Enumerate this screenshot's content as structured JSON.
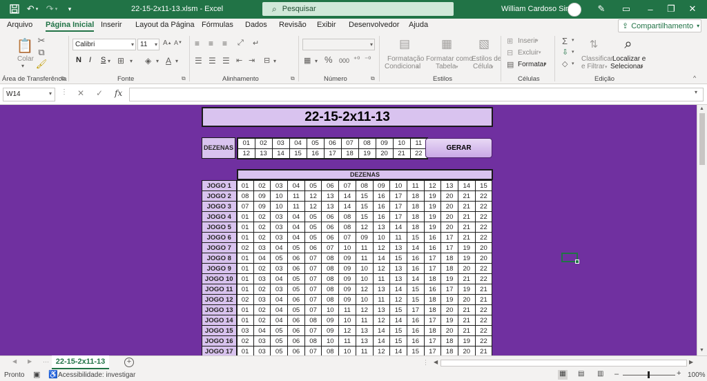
{
  "titlebar": {
    "filename": "22-15-2x11-13.xlsm  -  Excel",
    "search_placeholder": "Pesquisar",
    "user_name": "William Cardoso Simas"
  },
  "tabs": [
    "Arquivo",
    "Página Inicial",
    "Inserir",
    "Layout da Página",
    "Fórmulas",
    "Dados",
    "Revisão",
    "Exibir",
    "Desenvolvedor",
    "Ajuda"
  ],
  "share_label": "Compartilhamento",
  "ribbon": {
    "clipboard": {
      "label": "Área de Transferência",
      "paste": "Colar"
    },
    "font": {
      "label": "Fonte",
      "name": "Calibri",
      "size": "11",
      "bold": "N",
      "italic": "I",
      "underline": "S"
    },
    "alignment": {
      "label": "Alinhamento"
    },
    "number": {
      "label": "Número",
      "percent": "%",
      "thousands": "000"
    },
    "styles": {
      "label": "Estilos",
      "conditional_1": "Formatação",
      "conditional_2": "Condicional",
      "table_1": "Formatar como",
      "table_2": "Tabela",
      "cell_1": "Estilos de",
      "cell_2": "Célula"
    },
    "cells": {
      "label": "Células",
      "insert": "Inserir",
      "delete": "Excluir",
      "format": "Formatar"
    },
    "editing": {
      "label": "Edição",
      "sort_1": "Classificar",
      "sort_2": "e Filtrar",
      "find_1": "Localizar e",
      "find_2": "Selecionar"
    }
  },
  "formula_bar": {
    "name_box": "W14",
    "fx": "fx",
    "value": ""
  },
  "sheet": {
    "title": "22-15-2x11-13",
    "dezenas_label": "DEZENAS",
    "dezenas_row1": [
      "01",
      "02",
      "03",
      "04",
      "05",
      "06",
      "07",
      "08",
      "09",
      "10",
      "11"
    ],
    "dezenas_row2": [
      "12",
      "13",
      "14",
      "15",
      "16",
      "17",
      "18",
      "19",
      "20",
      "21",
      "22"
    ],
    "gerar_label": "GERAR",
    "games_header": "DEZENAS",
    "games": [
      {
        "label": "JOGO 1",
        "nums": [
          "01",
          "02",
          "03",
          "04",
          "05",
          "06",
          "07",
          "08",
          "09",
          "10",
          "11",
          "12",
          "13",
          "14",
          "15"
        ]
      },
      {
        "label": "JOGO 2",
        "nums": [
          "08",
          "09",
          "10",
          "11",
          "12",
          "13",
          "14",
          "15",
          "16",
          "17",
          "18",
          "19",
          "20",
          "21",
          "22"
        ]
      },
      {
        "label": "JOGO 3",
        "nums": [
          "07",
          "09",
          "10",
          "11",
          "12",
          "13",
          "14",
          "15",
          "16",
          "17",
          "18",
          "19",
          "20",
          "21",
          "22"
        ]
      },
      {
        "label": "JOGO 4",
        "nums": [
          "01",
          "02",
          "03",
          "04",
          "05",
          "06",
          "08",
          "15",
          "16",
          "17",
          "18",
          "19",
          "20",
          "21",
          "22"
        ]
      },
      {
        "label": "JOGO 5",
        "nums": [
          "01",
          "02",
          "03",
          "04",
          "05",
          "06",
          "08",
          "12",
          "13",
          "14",
          "18",
          "19",
          "20",
          "21",
          "22"
        ]
      },
      {
        "label": "JOGO 6",
        "nums": [
          "01",
          "02",
          "03",
          "04",
          "05",
          "06",
          "07",
          "09",
          "10",
          "11",
          "15",
          "16",
          "17",
          "21",
          "22"
        ]
      },
      {
        "label": "JOGO 7",
        "nums": [
          "02",
          "03",
          "04",
          "05",
          "06",
          "07",
          "10",
          "11",
          "12",
          "13",
          "14",
          "16",
          "17",
          "19",
          "20"
        ]
      },
      {
        "label": "JOGO 8",
        "nums": [
          "01",
          "04",
          "05",
          "06",
          "07",
          "08",
          "09",
          "11",
          "14",
          "15",
          "16",
          "17",
          "18",
          "19",
          "20"
        ]
      },
      {
        "label": "JOGO 9",
        "nums": [
          "01",
          "02",
          "03",
          "06",
          "07",
          "08",
          "09",
          "10",
          "12",
          "13",
          "16",
          "17",
          "18",
          "20",
          "22"
        ]
      },
      {
        "label": "JOGO 10",
        "nums": [
          "01",
          "03",
          "04",
          "05",
          "07",
          "08",
          "09",
          "10",
          "11",
          "13",
          "14",
          "18",
          "19",
          "21",
          "22"
        ]
      },
      {
        "label": "JOGO 11",
        "nums": [
          "01",
          "02",
          "03",
          "05",
          "07",
          "08",
          "09",
          "12",
          "13",
          "14",
          "15",
          "16",
          "17",
          "19",
          "21"
        ]
      },
      {
        "label": "JOGO 12",
        "nums": [
          "02",
          "03",
          "04",
          "06",
          "07",
          "08",
          "09",
          "10",
          "11",
          "12",
          "15",
          "18",
          "19",
          "20",
          "21"
        ]
      },
      {
        "label": "JOGO 13",
        "nums": [
          "01",
          "02",
          "04",
          "05",
          "07",
          "10",
          "11",
          "12",
          "13",
          "15",
          "17",
          "18",
          "20",
          "21",
          "22"
        ]
      },
      {
        "label": "JOGO 14",
        "nums": [
          "01",
          "02",
          "04",
          "06",
          "08",
          "09",
          "10",
          "11",
          "12",
          "14",
          "16",
          "17",
          "19",
          "21",
          "22"
        ]
      },
      {
        "label": "JOGO 15",
        "nums": [
          "03",
          "04",
          "05",
          "06",
          "07",
          "09",
          "12",
          "13",
          "14",
          "15",
          "16",
          "18",
          "20",
          "21",
          "22"
        ]
      },
      {
        "label": "JOGO 16",
        "nums": [
          "02",
          "03",
          "05",
          "06",
          "08",
          "10",
          "11",
          "13",
          "14",
          "15",
          "16",
          "17",
          "18",
          "19",
          "22"
        ]
      },
      {
        "label": "JOGO 17",
        "nums": [
          "01",
          "03",
          "05",
          "06",
          "07",
          "08",
          "10",
          "11",
          "12",
          "14",
          "15",
          "17",
          "18",
          "20",
          "21"
        ]
      }
    ]
  },
  "sheet_tab": "22-15-2x11-13",
  "status": {
    "ready": "Pronto",
    "accessibility": "Acessibilidade: investigar",
    "zoom": "100%"
  }
}
